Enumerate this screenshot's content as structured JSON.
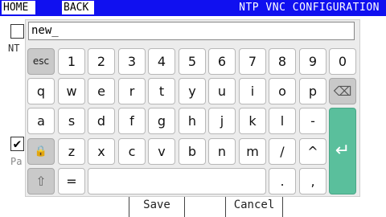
{
  "topbar": {
    "home": "HOME",
    "back": "BACK",
    "title": "NTP VNC CONFIGURATION"
  },
  "background_form": {
    "label_nt": "NT",
    "label_pa": "Pa",
    "checkbox2_mark": "✔",
    "save": "Save",
    "cancel": "Cancel"
  },
  "keyboard": {
    "input_value": "new_",
    "row1": [
      "esc",
      "1",
      "2",
      "3",
      "4",
      "5",
      "6",
      "7",
      "8",
      "9",
      "0"
    ],
    "row2": [
      "q",
      "w",
      "e",
      "r",
      "t",
      "y",
      "u",
      "i",
      "o",
      "p",
      "⌫"
    ],
    "row3": [
      "a",
      "s",
      "d",
      "f",
      "g",
      "h",
      "j",
      "k",
      "l",
      "-"
    ],
    "row4": [
      "🔒",
      "z",
      "x",
      "c",
      "v",
      "b",
      "n",
      "m",
      "/",
      "^"
    ],
    "row5": [
      "⇧",
      "=",
      "",
      ".",
      ","
    ],
    "enter": "↵"
  },
  "colors": {
    "topbar": "#1010f0",
    "enter_key": "#5abf9c",
    "keyboard_bg": "#ececec"
  }
}
